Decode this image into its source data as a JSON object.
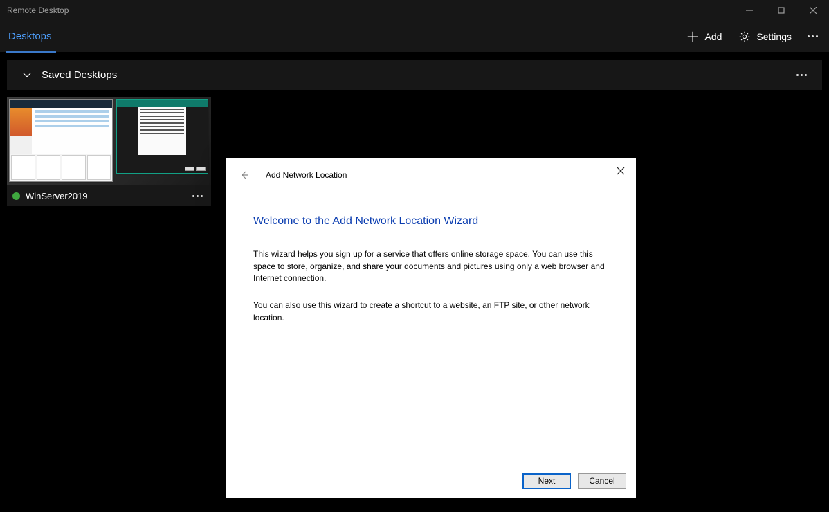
{
  "titlebar": {
    "title": "Remote Desktop"
  },
  "tabs": {
    "desktops": "Desktops"
  },
  "actions": {
    "add": "Add",
    "settings": "Settings"
  },
  "section": {
    "title": "Saved Desktops"
  },
  "tile": {
    "name": "WinServer2019",
    "status_color": "#3fa83f"
  },
  "wizard": {
    "title": "Add Network Location",
    "heading": "Welcome to the Add Network Location Wizard",
    "body_p1": "This wizard helps you sign up for a service that offers online storage space.  You can use this space to store, organize, and share your documents and pictures using only a web browser and Internet connection.",
    "body_p2": "You can also use this wizard to create a shortcut to a website, an FTP site, or other network location.",
    "buttons": {
      "next": "Next",
      "cancel": "Cancel"
    }
  }
}
